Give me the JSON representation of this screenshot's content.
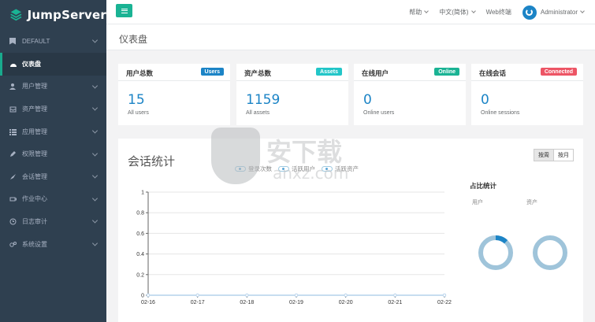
{
  "brand": {
    "name": "JumpServer"
  },
  "sidebar": {
    "org": "DEFAULT",
    "items": [
      {
        "label": "仪表盘",
        "icon": "dashboard-icon",
        "active": true
      },
      {
        "label": "用户管理",
        "icon": "users-icon"
      },
      {
        "label": "资产管理",
        "icon": "inbox-icon"
      },
      {
        "label": "应用管理",
        "icon": "th-icon"
      },
      {
        "label": "权限管理",
        "icon": "edit-icon"
      },
      {
        "label": "会话管理",
        "icon": "rocket-icon"
      },
      {
        "label": "作业中心",
        "icon": "coffee-icon"
      },
      {
        "label": "日志审计",
        "icon": "history-icon"
      },
      {
        "label": "系统设置",
        "icon": "gears-icon"
      }
    ]
  },
  "topbar": {
    "help": "帮助",
    "language": "中文(简体)",
    "web_terminal": "Web终端",
    "user": "Administrator"
  },
  "page": {
    "title": "仪表盘"
  },
  "cards": [
    {
      "title": "用户总数",
      "badge": "Users",
      "badge_color": "#1c84c6",
      "value": "15",
      "sub": "All users"
    },
    {
      "title": "资产总数",
      "badge": "Assets",
      "badge_color": "#23c6c8",
      "value": "1159",
      "sub": "All assets"
    },
    {
      "title": "在线用户",
      "badge": "Online",
      "badge_color": "#1ab394",
      "value": "0",
      "sub": "Online users"
    },
    {
      "title": "在线会话",
      "badge": "Connected",
      "badge_color": "#ed5565",
      "value": "0",
      "sub": "Online sessions"
    }
  ],
  "sessions": {
    "title": "会话统计",
    "range_buttons": [
      "按周",
      "按月"
    ],
    "legend": [
      "登录次数",
      "活跃用户",
      "活跃资产"
    ],
    "ratio_title": "占比统计",
    "ratio_labels": [
      "用户",
      "资产"
    ]
  },
  "watermark": {
    "text": "安下载",
    "url": "anxz.com"
  },
  "chart_data": {
    "type": "line",
    "categories": [
      "02-16",
      "02-17",
      "02-18",
      "02-19",
      "02-20",
      "02-21",
      "02-22"
    ],
    "series": [
      {
        "name": "登录次数",
        "values": [
          0,
          0,
          0,
          0,
          0,
          0,
          0
        ]
      },
      {
        "name": "活跃用户",
        "values": [
          0,
          0,
          0,
          0,
          0,
          0,
          0
        ]
      },
      {
        "name": "活跃资产",
        "values": [
          0,
          0,
          0,
          0,
          0,
          0,
          0
        ]
      }
    ],
    "ylim": [
      0,
      1
    ],
    "yticks": [
      "0",
      "0.2",
      "0.4",
      "0.6",
      "0.8",
      "1"
    ],
    "grid": true,
    "legend_position": "top"
  },
  "ratio_data": [
    {
      "label": "用户",
      "active_fraction": 0.12
    },
    {
      "label": "资产",
      "active_fraction": 0
    }
  ],
  "colors": {
    "accent": "#1ab394",
    "sidebar": "#2f4050",
    "link": "#1c84c6"
  }
}
